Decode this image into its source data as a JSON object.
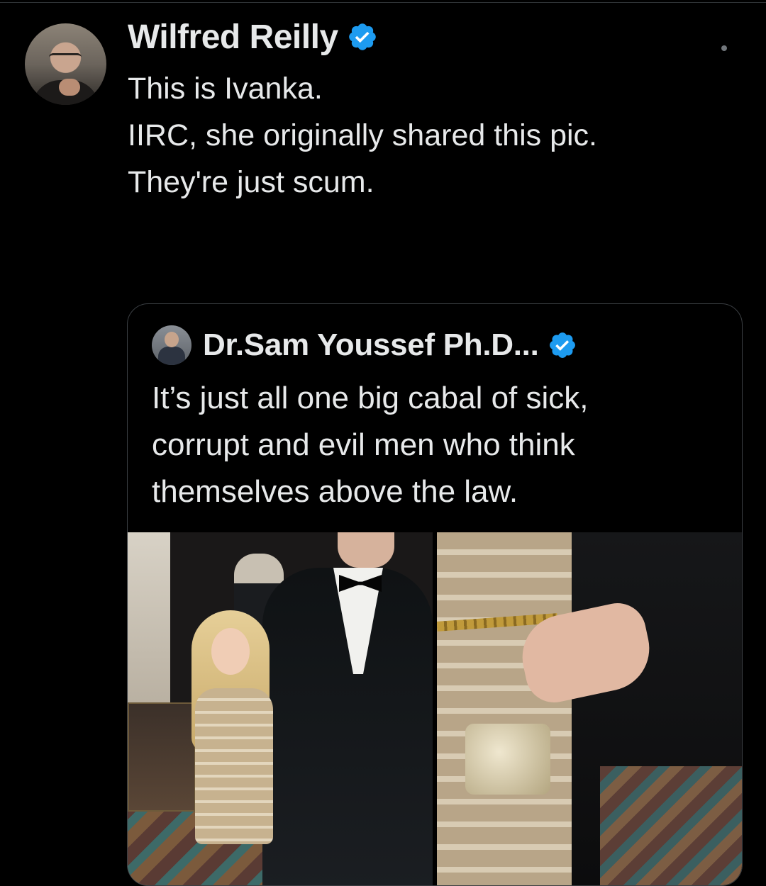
{
  "tweet": {
    "author_name": "Wilfred Reilly",
    "verified": true,
    "text_lines": [
      "This is Ivanka.",
      "",
      "IIRC, she originally shared this pic.",
      "",
      "They're just scum."
    ]
  },
  "quoted_tweet": {
    "author_name": "Dr.Sam Youssef Ph.D...",
    "verified": true,
    "text_lines": [
      "It’s just all one big cabal of sick,",
      "corrupt and evil men who think",
      "themselves above the law."
    ]
  },
  "colors": {
    "background": "#000000",
    "text": "#e7e9ea",
    "verified_blue": "#1d9bf0",
    "border": "#3a3e42"
  },
  "icons": {
    "verified": "verified-badge-icon",
    "more": "more-options-icon"
  }
}
